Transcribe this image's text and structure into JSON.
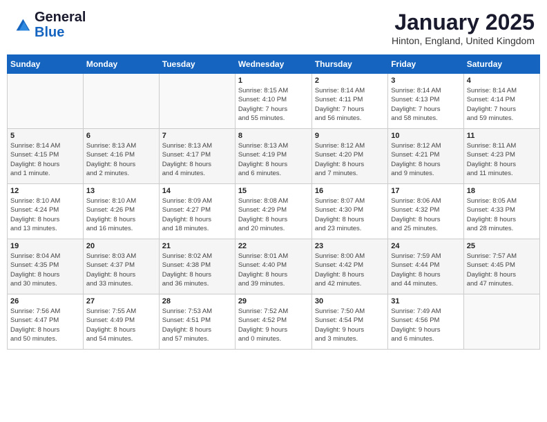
{
  "header": {
    "logo_general": "General",
    "logo_blue": "Blue",
    "month": "January 2025",
    "location": "Hinton, England, United Kingdom"
  },
  "weekdays": [
    "Sunday",
    "Monday",
    "Tuesday",
    "Wednesday",
    "Thursday",
    "Friday",
    "Saturday"
  ],
  "weeks": [
    [
      {
        "day": "",
        "info": ""
      },
      {
        "day": "",
        "info": ""
      },
      {
        "day": "",
        "info": ""
      },
      {
        "day": "1",
        "info": "Sunrise: 8:15 AM\nSunset: 4:10 PM\nDaylight: 7 hours\nand 55 minutes."
      },
      {
        "day": "2",
        "info": "Sunrise: 8:14 AM\nSunset: 4:11 PM\nDaylight: 7 hours\nand 56 minutes."
      },
      {
        "day": "3",
        "info": "Sunrise: 8:14 AM\nSunset: 4:13 PM\nDaylight: 7 hours\nand 58 minutes."
      },
      {
        "day": "4",
        "info": "Sunrise: 8:14 AM\nSunset: 4:14 PM\nDaylight: 7 hours\nand 59 minutes."
      }
    ],
    [
      {
        "day": "5",
        "info": "Sunrise: 8:14 AM\nSunset: 4:15 PM\nDaylight: 8 hours\nand 1 minute."
      },
      {
        "day": "6",
        "info": "Sunrise: 8:13 AM\nSunset: 4:16 PM\nDaylight: 8 hours\nand 2 minutes."
      },
      {
        "day": "7",
        "info": "Sunrise: 8:13 AM\nSunset: 4:17 PM\nDaylight: 8 hours\nand 4 minutes."
      },
      {
        "day": "8",
        "info": "Sunrise: 8:13 AM\nSunset: 4:19 PM\nDaylight: 8 hours\nand 6 minutes."
      },
      {
        "day": "9",
        "info": "Sunrise: 8:12 AM\nSunset: 4:20 PM\nDaylight: 8 hours\nand 7 minutes."
      },
      {
        "day": "10",
        "info": "Sunrise: 8:12 AM\nSunset: 4:21 PM\nDaylight: 8 hours\nand 9 minutes."
      },
      {
        "day": "11",
        "info": "Sunrise: 8:11 AM\nSunset: 4:23 PM\nDaylight: 8 hours\nand 11 minutes."
      }
    ],
    [
      {
        "day": "12",
        "info": "Sunrise: 8:10 AM\nSunset: 4:24 PM\nDaylight: 8 hours\nand 13 minutes."
      },
      {
        "day": "13",
        "info": "Sunrise: 8:10 AM\nSunset: 4:26 PM\nDaylight: 8 hours\nand 16 minutes."
      },
      {
        "day": "14",
        "info": "Sunrise: 8:09 AM\nSunset: 4:27 PM\nDaylight: 8 hours\nand 18 minutes."
      },
      {
        "day": "15",
        "info": "Sunrise: 8:08 AM\nSunset: 4:29 PM\nDaylight: 8 hours\nand 20 minutes."
      },
      {
        "day": "16",
        "info": "Sunrise: 8:07 AM\nSunset: 4:30 PM\nDaylight: 8 hours\nand 23 minutes."
      },
      {
        "day": "17",
        "info": "Sunrise: 8:06 AM\nSunset: 4:32 PM\nDaylight: 8 hours\nand 25 minutes."
      },
      {
        "day": "18",
        "info": "Sunrise: 8:05 AM\nSunset: 4:33 PM\nDaylight: 8 hours\nand 28 minutes."
      }
    ],
    [
      {
        "day": "19",
        "info": "Sunrise: 8:04 AM\nSunset: 4:35 PM\nDaylight: 8 hours\nand 30 minutes."
      },
      {
        "day": "20",
        "info": "Sunrise: 8:03 AM\nSunset: 4:37 PM\nDaylight: 8 hours\nand 33 minutes."
      },
      {
        "day": "21",
        "info": "Sunrise: 8:02 AM\nSunset: 4:38 PM\nDaylight: 8 hours\nand 36 minutes."
      },
      {
        "day": "22",
        "info": "Sunrise: 8:01 AM\nSunset: 4:40 PM\nDaylight: 8 hours\nand 39 minutes."
      },
      {
        "day": "23",
        "info": "Sunrise: 8:00 AM\nSunset: 4:42 PM\nDaylight: 8 hours\nand 42 minutes."
      },
      {
        "day": "24",
        "info": "Sunrise: 7:59 AM\nSunset: 4:44 PM\nDaylight: 8 hours\nand 44 minutes."
      },
      {
        "day": "25",
        "info": "Sunrise: 7:57 AM\nSunset: 4:45 PM\nDaylight: 8 hours\nand 47 minutes."
      }
    ],
    [
      {
        "day": "26",
        "info": "Sunrise: 7:56 AM\nSunset: 4:47 PM\nDaylight: 8 hours\nand 50 minutes."
      },
      {
        "day": "27",
        "info": "Sunrise: 7:55 AM\nSunset: 4:49 PM\nDaylight: 8 hours\nand 54 minutes."
      },
      {
        "day": "28",
        "info": "Sunrise: 7:53 AM\nSunset: 4:51 PM\nDaylight: 8 hours\nand 57 minutes."
      },
      {
        "day": "29",
        "info": "Sunrise: 7:52 AM\nSunset: 4:52 PM\nDaylight: 9 hours\nand 0 minutes."
      },
      {
        "day": "30",
        "info": "Sunrise: 7:50 AM\nSunset: 4:54 PM\nDaylight: 9 hours\nand 3 minutes."
      },
      {
        "day": "31",
        "info": "Sunrise: 7:49 AM\nSunset: 4:56 PM\nDaylight: 9 hours\nand 6 minutes."
      },
      {
        "day": "",
        "info": ""
      }
    ]
  ]
}
